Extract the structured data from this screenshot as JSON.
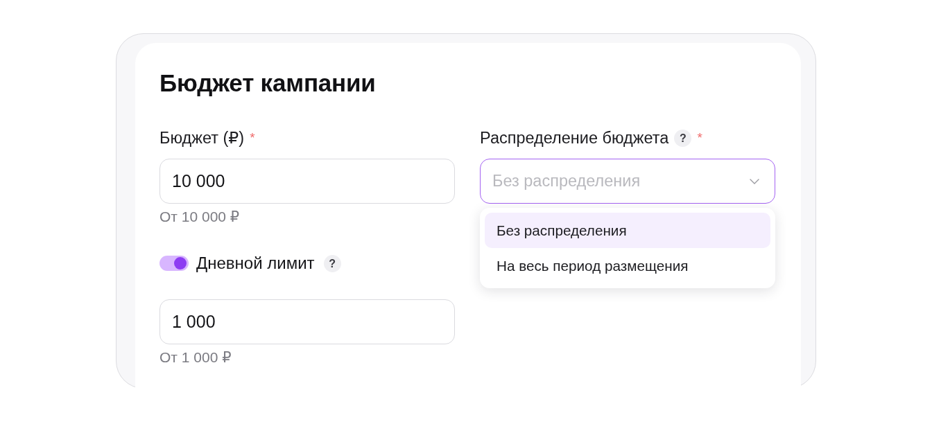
{
  "card": {
    "title": "Бюджет кампании"
  },
  "budget": {
    "label": "Бюджет (₽)",
    "required_mark": "*",
    "value": "10 000",
    "hint": "От 10 000 ₽"
  },
  "distribution": {
    "label": "Распределение бюджета",
    "help": "?",
    "required_mark": "*",
    "placeholder": "Без распределения",
    "expanded": true,
    "options": [
      {
        "label": "Без распределения",
        "selected": true
      },
      {
        "label": "На весь период размещения",
        "selected": false
      }
    ]
  },
  "daily_limit": {
    "label": "Дневной лимит",
    "on": true,
    "help": "?",
    "value": "1 000",
    "hint": "От 1 000 ₽"
  }
}
